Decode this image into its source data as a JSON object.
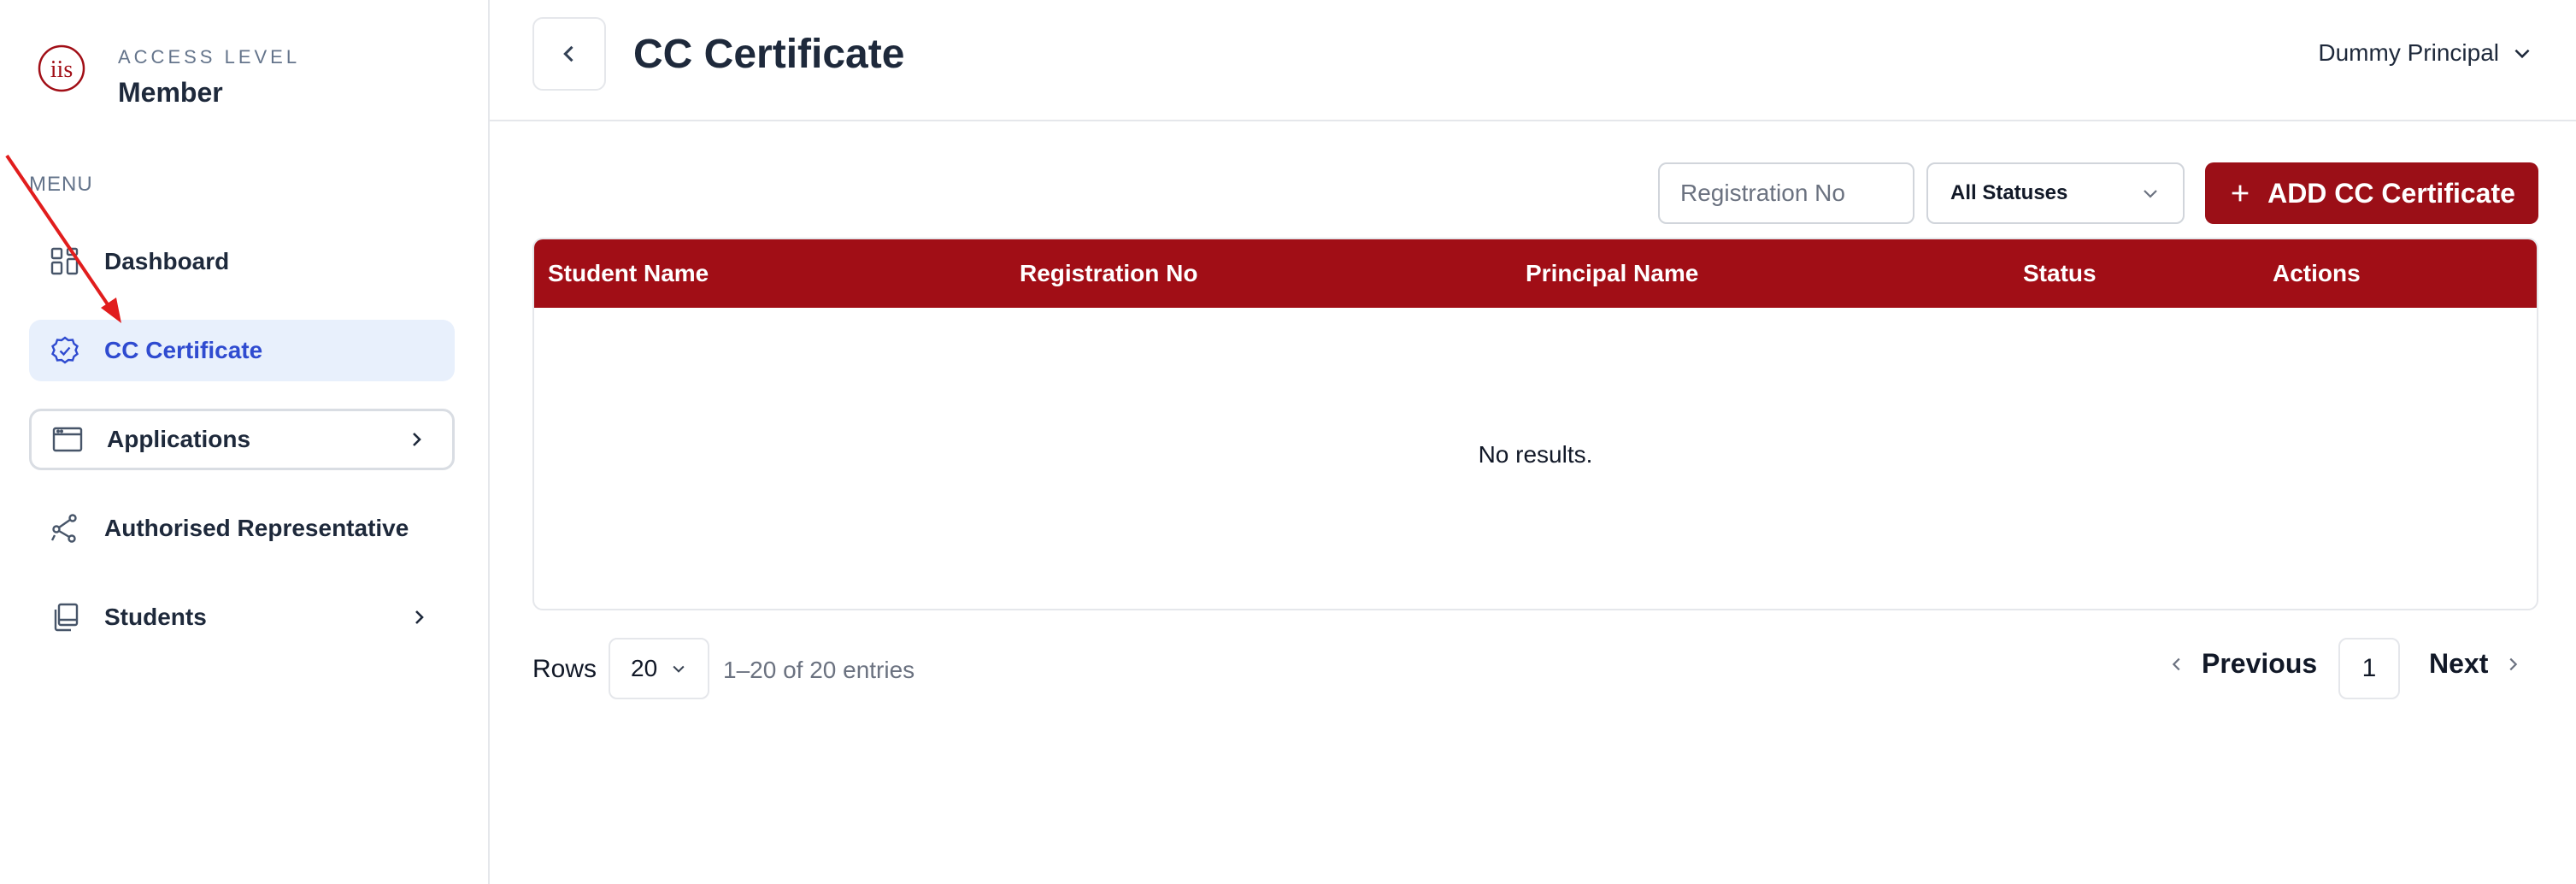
{
  "sidebar": {
    "brand": {
      "logo_icon": "iis-logo",
      "access_label": "ACCESS LEVEL",
      "access_value": "Member"
    },
    "menu_label": "MENU",
    "items": [
      {
        "label": "Dashboard",
        "icon": "dashboard-grid-icon",
        "state": "default"
      },
      {
        "label": "CC Certificate",
        "icon": "badge-check-icon",
        "state": "active"
      },
      {
        "label": "Applications",
        "icon": "browser-window-icon",
        "state": "expandable"
      },
      {
        "label": "Authorised Representative",
        "icon": "nodes-icon",
        "state": "default"
      },
      {
        "label": "Students",
        "icon": "copy-stack-icon",
        "state": "expandable"
      }
    ]
  },
  "header": {
    "back_icon": "chevron-left-icon",
    "title": "CC Certificate",
    "user_name": "Dummy Principal"
  },
  "toolbar": {
    "search_placeholder": "Registration No",
    "status_filter_value": "All Statuses",
    "add_button_label": "ADD CC Certificate"
  },
  "table": {
    "columns": [
      "Student Name",
      "Registration No",
      "Principal Name",
      "Status",
      "Actions"
    ],
    "rows": [],
    "empty_message": "No results."
  },
  "pagination": {
    "rows_label": "Rows",
    "rows_per_page": "20",
    "entries_text": "1–20 of 20 entries",
    "previous_label": "Previous",
    "current_page": "1",
    "next_label": "Next"
  },
  "colors": {
    "brand_red": "#9b0f17",
    "active_bg": "#e8f0fc",
    "active_text": "#2f4bd0"
  }
}
